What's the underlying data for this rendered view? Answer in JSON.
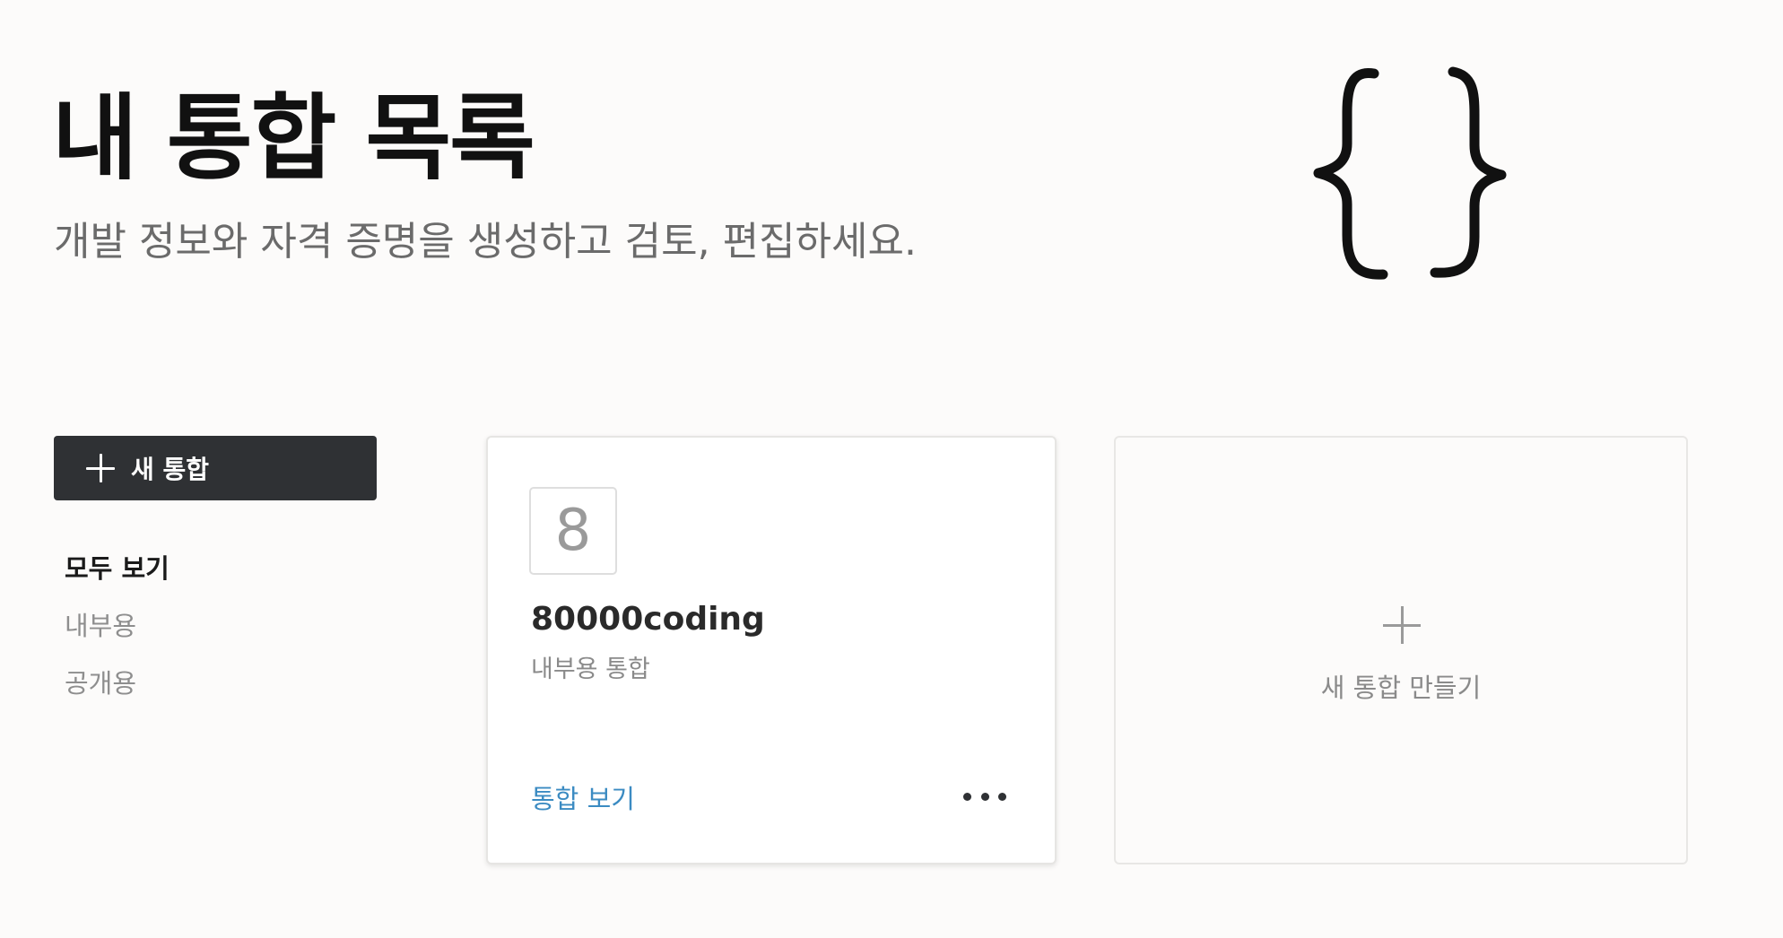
{
  "header": {
    "title": "내 통합 목록",
    "subtitle": "개발 정보와 자격 증명을 생성하고 검토, 편집하세요."
  },
  "hero": {
    "icon": "curly-braces-icon"
  },
  "sidebar": {
    "new_button_label": "새 통합",
    "new_button_icon": "plus-icon",
    "filters": [
      {
        "label": "모두 보기",
        "active": true
      },
      {
        "label": "내부용",
        "active": false
      },
      {
        "label": "공개용",
        "active": false
      }
    ]
  },
  "integrations": [
    {
      "avatar": "8",
      "name": "80000coding",
      "type": "내부용 통합",
      "link_label": "통합 보기",
      "more_icon": "more-horizontal-icon"
    }
  ],
  "create_card": {
    "label": "새 통합 만들기",
    "icon": "plus-icon"
  },
  "colors": {
    "background": "#fcfbfa",
    "button_dark": "#2f3134",
    "link": "#3b8bc2",
    "muted_text": "#8a8a8a"
  }
}
